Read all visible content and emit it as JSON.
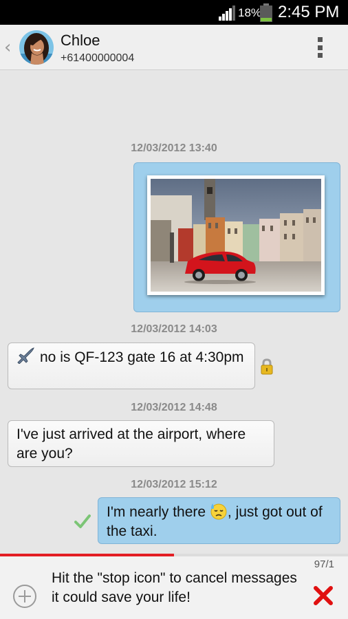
{
  "status_bar": {
    "battery_percent": "18%",
    "time": "2:45 PM",
    "icons": [
      "signal-icon",
      "battery-icon"
    ]
  },
  "header": {
    "back_icon": "back-chevron-icon",
    "name": "Chloe",
    "phone": "+61400000004",
    "menu_icon": "overflow-menu-icon"
  },
  "conversation": {
    "messages": [
      {
        "timestamp": "12/03/2012 13:40",
        "direction": "outgoing",
        "type": "image",
        "image_description": "photo"
      },
      {
        "timestamp": "12/03/2012 14:03",
        "direction": "incoming",
        "icon": "airplane-icon",
        "text": "no is QF-123 gate 16 at 4:30pm",
        "status_icon": "lock-icon"
      },
      {
        "timestamp": "12/03/2012 14:48",
        "direction": "incoming",
        "text": "I've just arrived at the airport, where are you?"
      },
      {
        "timestamp": "12/03/2012 15:12",
        "direction": "outgoing",
        "text_before": "I'm nearly there ",
        "emoji": "sweat-face-icon",
        "text_after": ", just got out of the taxi.",
        "status_icon": "checkmark-icon"
      }
    ]
  },
  "composer": {
    "progress": 0.5,
    "counter": "97/1",
    "text": "Hit the \"stop icon\" to cancel messages it could save your life!",
    "add_icon": "add-circle-icon",
    "cancel_icon": "cancel-x-icon"
  },
  "colors": {
    "outgoing_bubble": "#9fcfec",
    "incoming_bubble": "#f5f5f5",
    "background": "#e6e6e6",
    "progress": "#e31e24",
    "cancel": "#e01010",
    "check": "#7cc576",
    "lock": "#e7b820"
  }
}
